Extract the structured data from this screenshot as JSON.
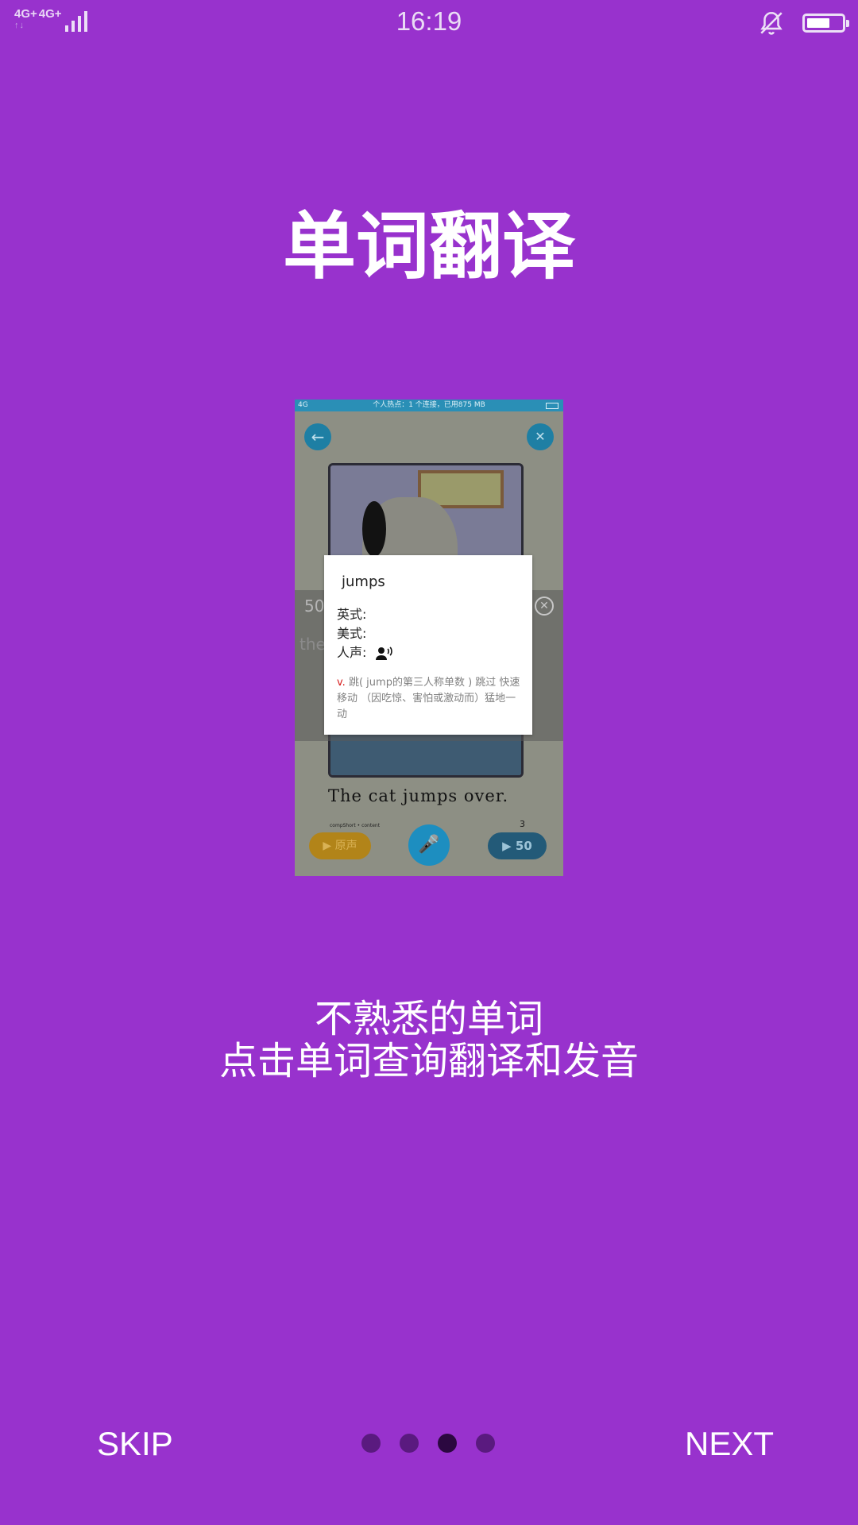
{
  "status_bar": {
    "network_1": "4G+",
    "network_2": "4G+",
    "time": "16:19",
    "icons": [
      "signal-icon",
      "bell-off-icon",
      "battery-icon"
    ]
  },
  "title": "单词翻译",
  "preview": {
    "status_text": "个人热点：1 个连接，已用875 MB",
    "carrier": "4G",
    "number": "50",
    "faded_text": "the",
    "sentence": "The cat jumps over.",
    "small_caption": "compShort • content",
    "count": "3",
    "original_button": "▶ 原声",
    "play_button": "▶ 50"
  },
  "popup": {
    "word": "jumps",
    "british_label": "英式:",
    "american_label": "美式:",
    "voice_label": "人声:",
    "part_of_speech": "v.",
    "definition": "跳( jump的第三人称单数 ) 跳过 快速移动 （因吃惊、害怕或激动而）猛地一动"
  },
  "subtitle": {
    "line1": "不熟悉的单词",
    "line2": "点击单词查询翻译和发音"
  },
  "nav": {
    "skip": "SKIP",
    "next": "NEXT",
    "page_count": 4,
    "active_page": 3
  },
  "colors": {
    "background": "#9832cd",
    "dot_inactive": "#5a1a7f",
    "dot_active": "#2b0840"
  }
}
